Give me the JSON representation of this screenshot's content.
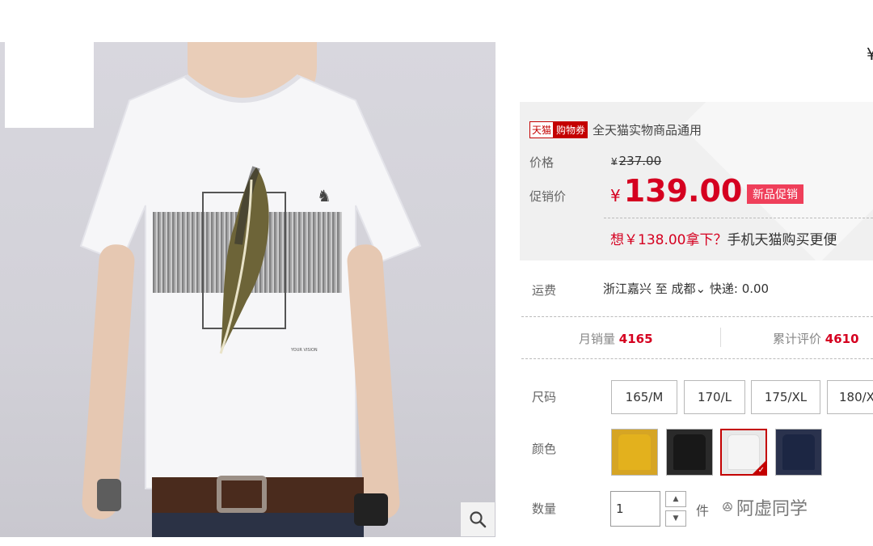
{
  "image": {
    "print_mark": "YOUR VISION",
    "logo_glyph": "♞"
  },
  "header": {
    "partial_glyph": "¥"
  },
  "coupon": {
    "tag_tmall": "天猫",
    "tag_coupon": "购物券",
    "text": "全天猫实物商品通用"
  },
  "price": {
    "label": "价格",
    "currency": "¥",
    "original": "237.00"
  },
  "promo_price": {
    "label": "促销价",
    "currency": "¥",
    "amount": "139.00",
    "badge": "新品促销"
  },
  "mobile_promo": {
    "highlight": "想￥138.00拿下？",
    "rest": "手机天猫购买更便"
  },
  "shipping": {
    "label": "运费",
    "text": "浙江嘉兴 至 成都⌄ 快递: 0.00"
  },
  "stats": {
    "monthly_sales_label": "月销量",
    "monthly_sales": "4165",
    "reviews_label": "累计评价",
    "reviews": "4610"
  },
  "size": {
    "label": "尺码",
    "options": [
      "165/M",
      "170/L",
      "175/XL",
      "180/X"
    ]
  },
  "color": {
    "label": "颜色",
    "swatches": [
      "#e3b11d",
      "#181818",
      "#f4f4f4",
      "#1c2643"
    ],
    "selected_index": 2
  },
  "quantity": {
    "label": "数量",
    "value": "1",
    "unit": "件"
  },
  "watermark": "阿虚同学",
  "colors": {
    "accent": "#d50020",
    "brand": "#c40000"
  }
}
